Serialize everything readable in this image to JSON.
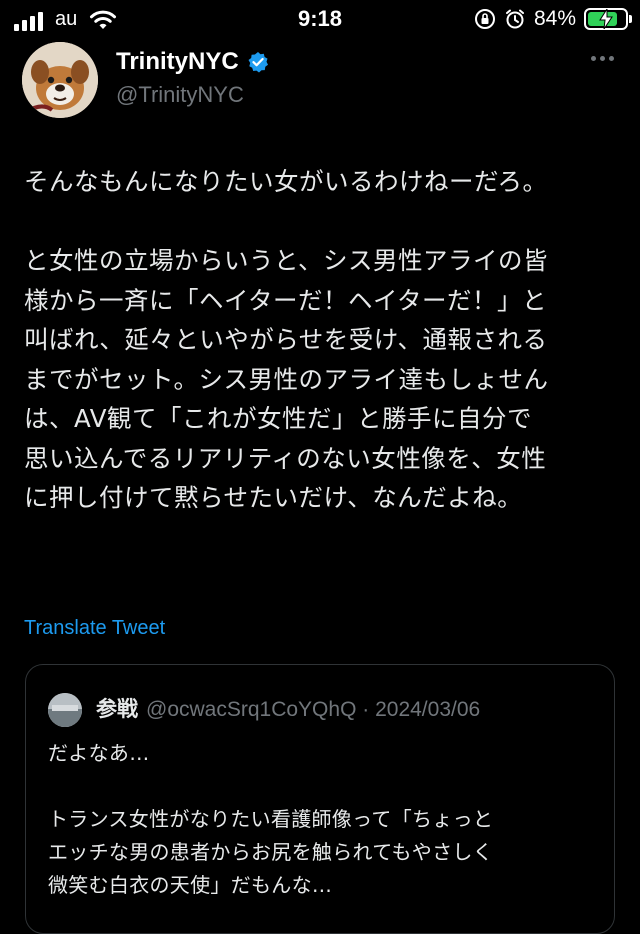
{
  "status_bar": {
    "carrier": "au",
    "time": "9:18",
    "battery_percent": "84%",
    "battery_level": 0.84,
    "icons": [
      "signal-icon",
      "wifi-icon",
      "orientation-lock-icon",
      "alarm-icon",
      "battery-charging-icon"
    ]
  },
  "tweet": {
    "author": {
      "display_name": "TrinityNYC",
      "handle": "@TrinityNYC",
      "verified": true
    },
    "body": {
      "line1": "そんなもんになりたい女がいるわけねーだろ。",
      "line2": "と女性の立場からいうと、シス男性アライの皆",
      "line3": "様から一斉に「ヘイターだ！ヘイターだ！」と",
      "line4": "叫ばれ、延々といやがらせを受け、通報される",
      "line5": "までがセット。シス男性のアライ達もしょせん",
      "line6": "は、AV観て「これが女性だ」と勝手に自分で",
      "line7": "思い込んでるリアリティのない女性像を、女性",
      "line8": "に押し付けて黙らせたいだけ、なんだよね。"
    },
    "translate_label": "Translate Tweet",
    "accent_color": "#1d9bf0",
    "verified_color": "#1d9bf0"
  },
  "quoted_tweet": {
    "display_name": "参戦",
    "handle": "@ocwacSrq1CoYQhQ",
    "separator": "·",
    "date": "2024/03/06",
    "line1": "だよなあ…",
    "line2": "トランス女性がなりたい看護師像って「ちょっと",
    "line3": "エッチな男の患者からお尻を触られてもやさしく",
    "line4": "微笑む白衣の天使」だもんな…"
  }
}
